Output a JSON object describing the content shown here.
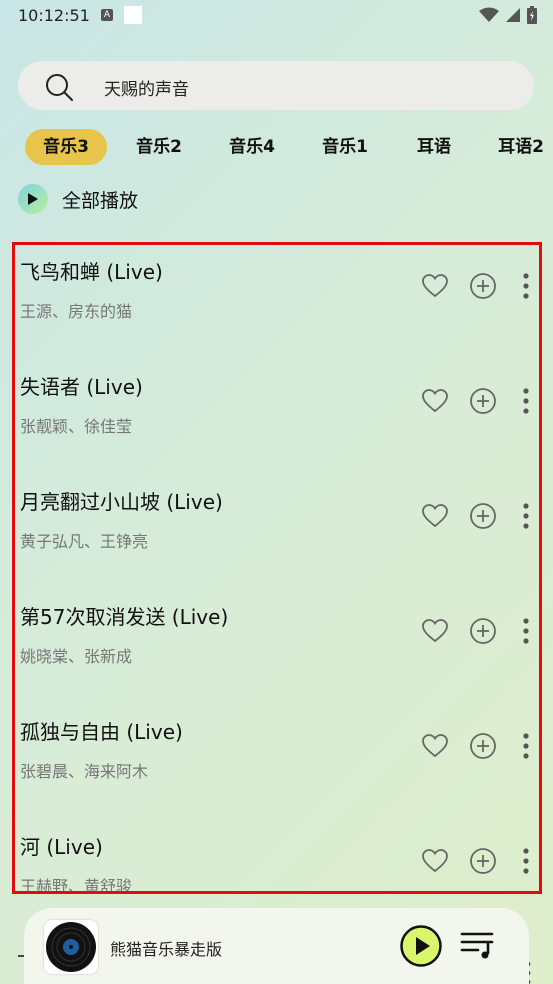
{
  "status_bar": {
    "time": "10:12:51",
    "a_icon": "A"
  },
  "search": {
    "text": "天赐的声音"
  },
  "tabs": [
    {
      "label": "音乐3",
      "active": true
    },
    {
      "label": "音乐2",
      "active": false
    },
    {
      "label": "音乐4",
      "active": false
    },
    {
      "label": "音乐1",
      "active": false
    },
    {
      "label": "耳语",
      "active": false
    },
    {
      "label": "耳语2",
      "active": false
    }
  ],
  "play_all": {
    "label": "全部播放"
  },
  "songs": [
    {
      "title": "飞鸟和蝉 (Live)",
      "artist": "王源、房东的猫"
    },
    {
      "title": "失语者 (Live)",
      "artist": "张靓颖、徐佳莹"
    },
    {
      "title": "月亮翻过小山坡 (Live)",
      "artist": "黄子弘凡、王铮亮"
    },
    {
      "title": "第57次取消发送 (Live)",
      "artist": "姚晓棠、张新成"
    },
    {
      "title": "孤独与自由 (Live)",
      "artist": "张碧晨、海来阿木"
    },
    {
      "title": "河 (Live)",
      "artist": "王赫野、黄舒骏"
    }
  ],
  "player": {
    "title": "熊猫音乐暴走版"
  },
  "colors": {
    "accent": "#e7c54a",
    "highlight_border": "#e10c0c",
    "play_button": "#d9f56b"
  },
  "icons": [
    "search-icon",
    "play-icon",
    "heart-icon",
    "add-circle-icon",
    "more-vertical-icon",
    "vinyl-disc-icon",
    "playlist-icon",
    "wifi-icon",
    "signal-icon",
    "battery-icon"
  ]
}
